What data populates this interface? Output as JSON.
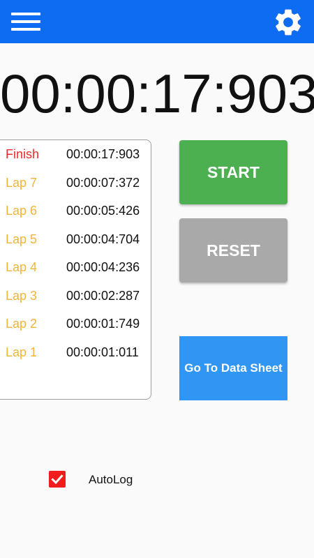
{
  "appbar": {
    "color": "#0d6cf2",
    "menu_icon": "hamburger-menu-icon",
    "settings_icon": "gear-icon"
  },
  "timer": {
    "display": "00:00:17:903"
  },
  "laps": [
    {
      "label": "Finish",
      "time": "00:00:17:903",
      "color": "#ef2a2a"
    },
    {
      "label": "Lap 7",
      "time": "00:00:07:372",
      "color": "#f3b43b"
    },
    {
      "label": "Lap 6",
      "time": "00:00:05:426",
      "color": "#f3b43b"
    },
    {
      "label": "Lap 5",
      "time": "00:00:04:704",
      "color": "#f3b43b"
    },
    {
      "label": "Lap 4",
      "time": "00:00:04:236",
      "color": "#f3b43b"
    },
    {
      "label": "Lap 3",
      "time": "00:00:02:287",
      "color": "#f3b43b"
    },
    {
      "label": "Lap 2",
      "time": "00:00:01:749",
      "color": "#f3b43b"
    },
    {
      "label": "Lap 1",
      "time": "00:00:01:011",
      "color": "#f3b43b"
    }
  ],
  "buttons": {
    "start_label": "START",
    "start_color": "#4caf50",
    "reset_label": "RESET",
    "reset_color": "#a9a9a9",
    "datasheet_label": "Go To Data Sheet",
    "datasheet_color": "#3196f3"
  },
  "autolog": {
    "label": "AutoLog",
    "checked": true,
    "color": "#ef1d1d"
  }
}
